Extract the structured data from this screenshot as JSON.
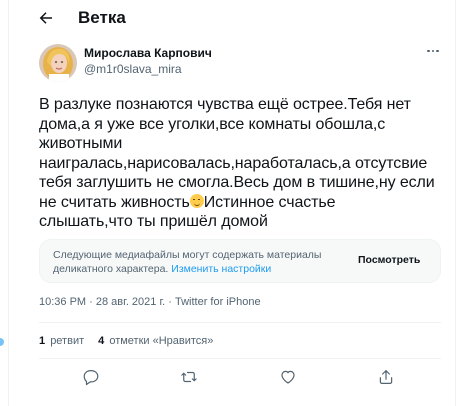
{
  "header": {
    "title": "Ветка",
    "back_icon": "arrow-left-icon"
  },
  "author": {
    "name": "Мирослава Карпович",
    "handle": "@m1r0slava_mira",
    "avatar_icon": "avatar-photo"
  },
  "tweet": {
    "lines": [
      "В разлуке познаются чувства ещё острее.Тебя нет",
      "дома,а я уже все уголки,все комнаты обошла,с",
      "животными",
      "наигралась,нарисовалась,наработалась,а отсутсвие",
      "тебя заглушить не смогла.Весь дом в тишине,ну если",
      "не считать живность",
      "Истинное счастье",
      "слышать,что ты пришёл домой"
    ],
    "emoji_icon": "relieved-face-emoji"
  },
  "sensitive": {
    "text_line1": "Следующие медиафайлы могут содержать материалы",
    "text_line2": "деликатного характера.",
    "link": "Изменить настройки",
    "button": "Посмотреть"
  },
  "meta": {
    "time": "10:36 PM",
    "date": "28 авг. 2021 г.",
    "source": "Twitter for iPhone",
    "separator": "·"
  },
  "stats": {
    "retweets_count": "1",
    "retweets_label": "ретвит",
    "likes_count": "4",
    "likes_label": "отметки «Нравится»"
  },
  "actions": [
    "reply-icon",
    "retweet-icon",
    "like-icon",
    "share-icon"
  ],
  "colors": {
    "accent": "#1d9bf0",
    "text": "#0f1419",
    "secondary": "#536471",
    "border": "#eff3f4"
  }
}
